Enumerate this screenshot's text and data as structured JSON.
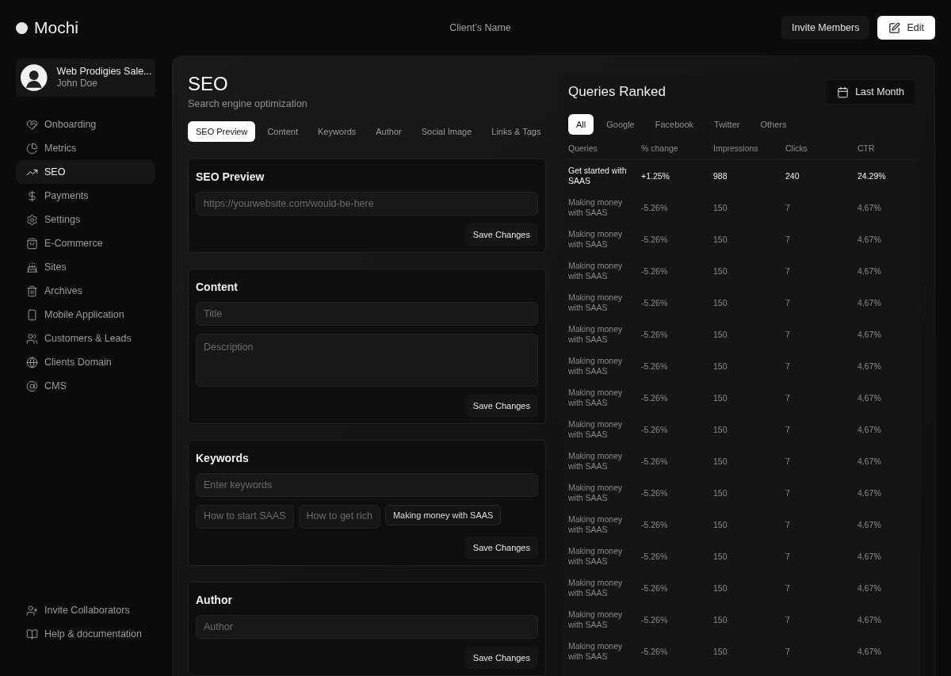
{
  "brand": {
    "name": "Mochi"
  },
  "header": {
    "client": "Client’s Name",
    "buttons": [
      {
        "label": "Invite Members",
        "kind": "secondary"
      },
      {
        "label": "Edit",
        "kind": "primary"
      }
    ]
  },
  "account": {
    "workspace": "Web Prodigies Sale...",
    "user": "John Doe"
  },
  "sidebar": {
    "items": [
      {
        "label": "Onboarding",
        "selected": false
      },
      {
        "label": "Metrics",
        "selected": false
      },
      {
        "label": "SEO",
        "selected": true
      },
      {
        "label": "Payments",
        "selected": false
      },
      {
        "label": "Settings",
        "selected": false
      },
      {
        "label": "E-Commerce",
        "selected": false
      },
      {
        "label": "Sites",
        "selected": false
      },
      {
        "label": "Archives",
        "selected": false
      },
      {
        "label": "Mobile Application",
        "selected": false
      },
      {
        "label": "Customers & Leads",
        "selected": false
      },
      {
        "label": "Clients Domain",
        "selected": false
      },
      {
        "label": "CMS",
        "selected": false
      }
    ],
    "footer": [
      {
        "label": "Invite Collaborators"
      },
      {
        "label": "Help & documentation"
      }
    ]
  },
  "page": {
    "title": "SEO",
    "subtitle": "Search engine optimization",
    "tabs": [
      {
        "label": "SEO Preview",
        "selected": true
      },
      {
        "label": "Content",
        "selected": false
      },
      {
        "label": "Keywords",
        "selected": false
      },
      {
        "label": "Author",
        "selected": false
      },
      {
        "label": "Social Image",
        "selected": false
      },
      {
        "label": "Links & Tags",
        "selected": false
      }
    ]
  },
  "sections": [
    {
      "title": "SEO Preview",
      "fields": [
        {
          "kind": "input",
          "placeholder": "https://yourwebsite.com/would-be-here"
        }
      ],
      "button": "Save Changes"
    },
    {
      "title": "Content",
      "fields": [
        {
          "kind": "input",
          "placeholder": "Title"
        },
        {
          "kind": "textarea",
          "placeholder": "Description"
        }
      ],
      "button": "Save Changes"
    },
    {
      "title": "Keywords",
      "fields": [
        {
          "kind": "input",
          "placeholder": "Enter keywords"
        },
        {
          "kind": "chips",
          "items": [
            {
              "label": "How to start SAAS",
              "selected": false
            },
            {
              "label": "How to get rich",
              "selected": false
            },
            {
              "label": "Making money with SAAS",
              "selected": true
            }
          ]
        }
      ],
      "button": "Save Changes"
    },
    {
      "title": "Author",
      "fields": [
        {
          "kind": "input",
          "placeholder": "Author"
        }
      ],
      "button": "Save Changes"
    }
  ],
  "queries": {
    "title": "Queries Ranked",
    "range": "Last Month",
    "filters": [
      {
        "label": "All",
        "selected": true
      },
      {
        "label": "Google",
        "selected": false
      },
      {
        "label": "Facebook",
        "selected": false
      },
      {
        "label": "Twitter",
        "selected": false
      },
      {
        "label": "Others",
        "selected": false
      }
    ],
    "columns": [
      "Queries",
      "% change",
      "Impressions",
      "Clicks",
      "CTR"
    ],
    "rows": [
      {
        "emphasized": true,
        "cells": [
          "Get started with SAAS",
          "+1.25%",
          "988",
          "240",
          "24.29%"
        ]
      },
      {
        "emphasized": false,
        "cells": [
          "Making money with SAAS",
          "-5.26%",
          "150",
          "7",
          "4.67%"
        ]
      },
      {
        "emphasized": false,
        "cells": [
          "Making money with SAAS",
          "-5.26%",
          "150",
          "7",
          "4.67%"
        ]
      },
      {
        "emphasized": false,
        "cells": [
          "Making money with SAAS",
          "-5.26%",
          "150",
          "7",
          "4.67%"
        ]
      },
      {
        "emphasized": false,
        "cells": [
          "Making money with SAAS",
          "-5.26%",
          "150",
          "7",
          "4.67%"
        ]
      },
      {
        "emphasized": false,
        "cells": [
          "Making money with SAAS",
          "-5.26%",
          "150",
          "7",
          "4.67%"
        ]
      },
      {
        "emphasized": false,
        "cells": [
          "Making money with SAAS",
          "-5.26%",
          "150",
          "7",
          "4.67%"
        ]
      },
      {
        "emphasized": false,
        "cells": [
          "Making money with SAAS",
          "-5.26%",
          "150",
          "7",
          "4.67%"
        ]
      },
      {
        "emphasized": false,
        "cells": [
          "Making money with SAAS",
          "-5.26%",
          "150",
          "7",
          "4.67%"
        ]
      },
      {
        "emphasized": false,
        "cells": [
          "Making money with SAAS",
          "-5.26%",
          "150",
          "7",
          "4.67%"
        ]
      },
      {
        "emphasized": false,
        "cells": [
          "Making money with SAAS",
          "-5.26%",
          "150",
          "7",
          "4.67%"
        ]
      },
      {
        "emphasized": false,
        "cells": [
          "Making money with SAAS",
          "-5.26%",
          "150",
          "7",
          "4.67%"
        ]
      },
      {
        "emphasized": false,
        "cells": [
          "Making money with SAAS",
          "-5.26%",
          "150",
          "7",
          "4.67%"
        ]
      },
      {
        "emphasized": false,
        "cells": [
          "Making money with SAAS",
          "-5.26%",
          "150",
          "7",
          "4.67%"
        ]
      },
      {
        "emphasized": false,
        "cells": [
          "Making money with SAAS",
          "-5.26%",
          "150",
          "7",
          "4.67%"
        ]
      },
      {
        "emphasized": false,
        "cells": [
          "Making money with SAAS",
          "-5.26%",
          "150",
          "7",
          "4.67%"
        ]
      }
    ]
  }
}
